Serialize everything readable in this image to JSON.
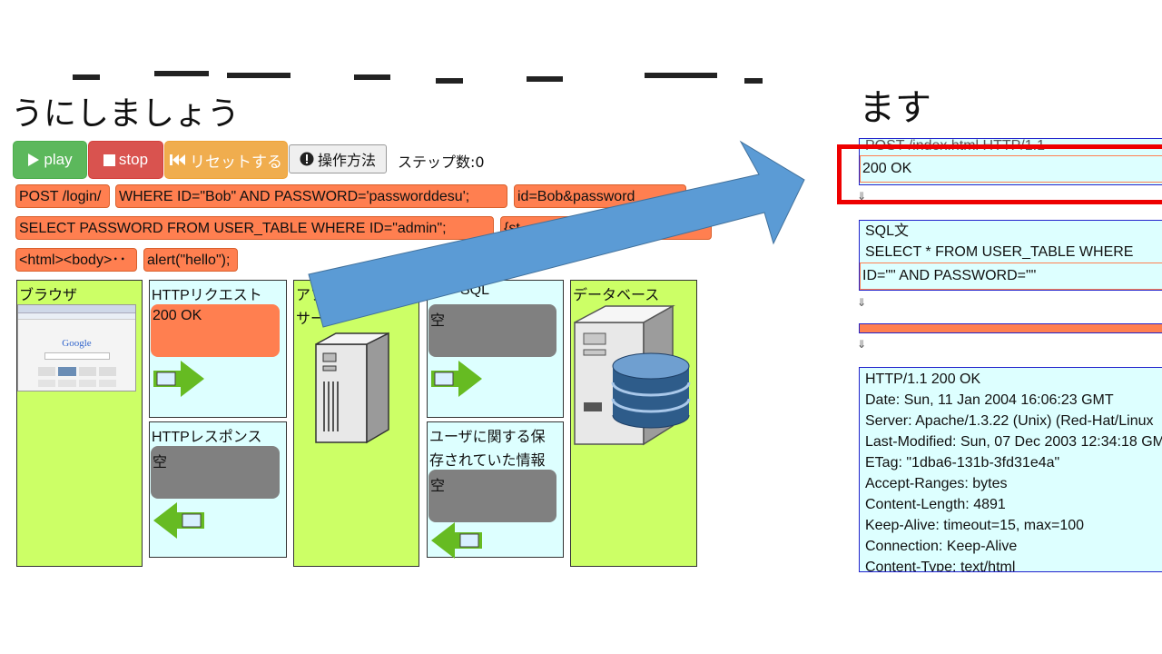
{
  "heading_left": "うにしましょう",
  "heading_right": "ます",
  "buttons": {
    "play": "play",
    "stop": "stop",
    "reset": "リセットする",
    "help": "操作方法"
  },
  "steps_label": "ステップ数:",
  "steps_value": "0",
  "chips": [
    "POST /login/",
    "WHERE ID=\"Bob\" AND PASSWORD='passworddesu';",
    "id=Bob&password",
    "SELECT PASSWORD FROM USER_TABLE WHERE ID=\"admin\";",
    "{st",
    "<html><body>･･",
    "alert(\"hello\");"
  ],
  "lanes": {
    "browser": "ブラウザ",
    "http_request": "HTTPリクエスト",
    "http_request_value": "200 OK",
    "http_response": "HTTPレスポンス",
    "http_response_value": "空",
    "app_server": "アプ",
    "app_server_line2": "サー",
    "sql_title": "SQL",
    "sql_value": "空",
    "user_info_line1": "ユーザに関する保",
    "user_info_line2": "存されていた情報",
    "user_info_value": "空",
    "database": "データベース"
  },
  "browser_thumbnail_text": "Google",
  "panels": {
    "request_line": "POST /index.html HTTP/1.1",
    "request_highlight": "200 OK",
    "sql_label": "SQL文",
    "sql_line1": "SELECT * FROM USER_TABLE WHERE",
    "sql_line2": "ID=\"\" AND PASSWORD=\"\"",
    "down_arrow": "⇓",
    "response_lines": [
      "HTTP/1.1 200 OK",
      "Date: Sun, 11 Jan 2004 16:06:23 GMT",
      "Server: Apache/1.3.22 (Unix) (Red-Hat/Linux",
      "Last-Modified: Sun, 07 Dec 2003 12:34:18 GM",
      "ETag: \"1dba6-131b-3fd31e4a\"",
      "Accept-Ranges: bytes",
      "Content-Length: 4891",
      "Keep-Alive: timeout=15, max=100",
      "Connection: Keep-Alive",
      "Content-Type: text/html"
    ]
  },
  "colors": {
    "play": "#5cb85c",
    "stop": "#d9534f",
    "reset": "#f0ad4e",
    "chip": "#ff7f50",
    "lane_green": "#ccff66",
    "lane_cyan": "#ddffff",
    "arrow_blue": "#5b9bd5",
    "highlight_red": "#ee0000"
  }
}
